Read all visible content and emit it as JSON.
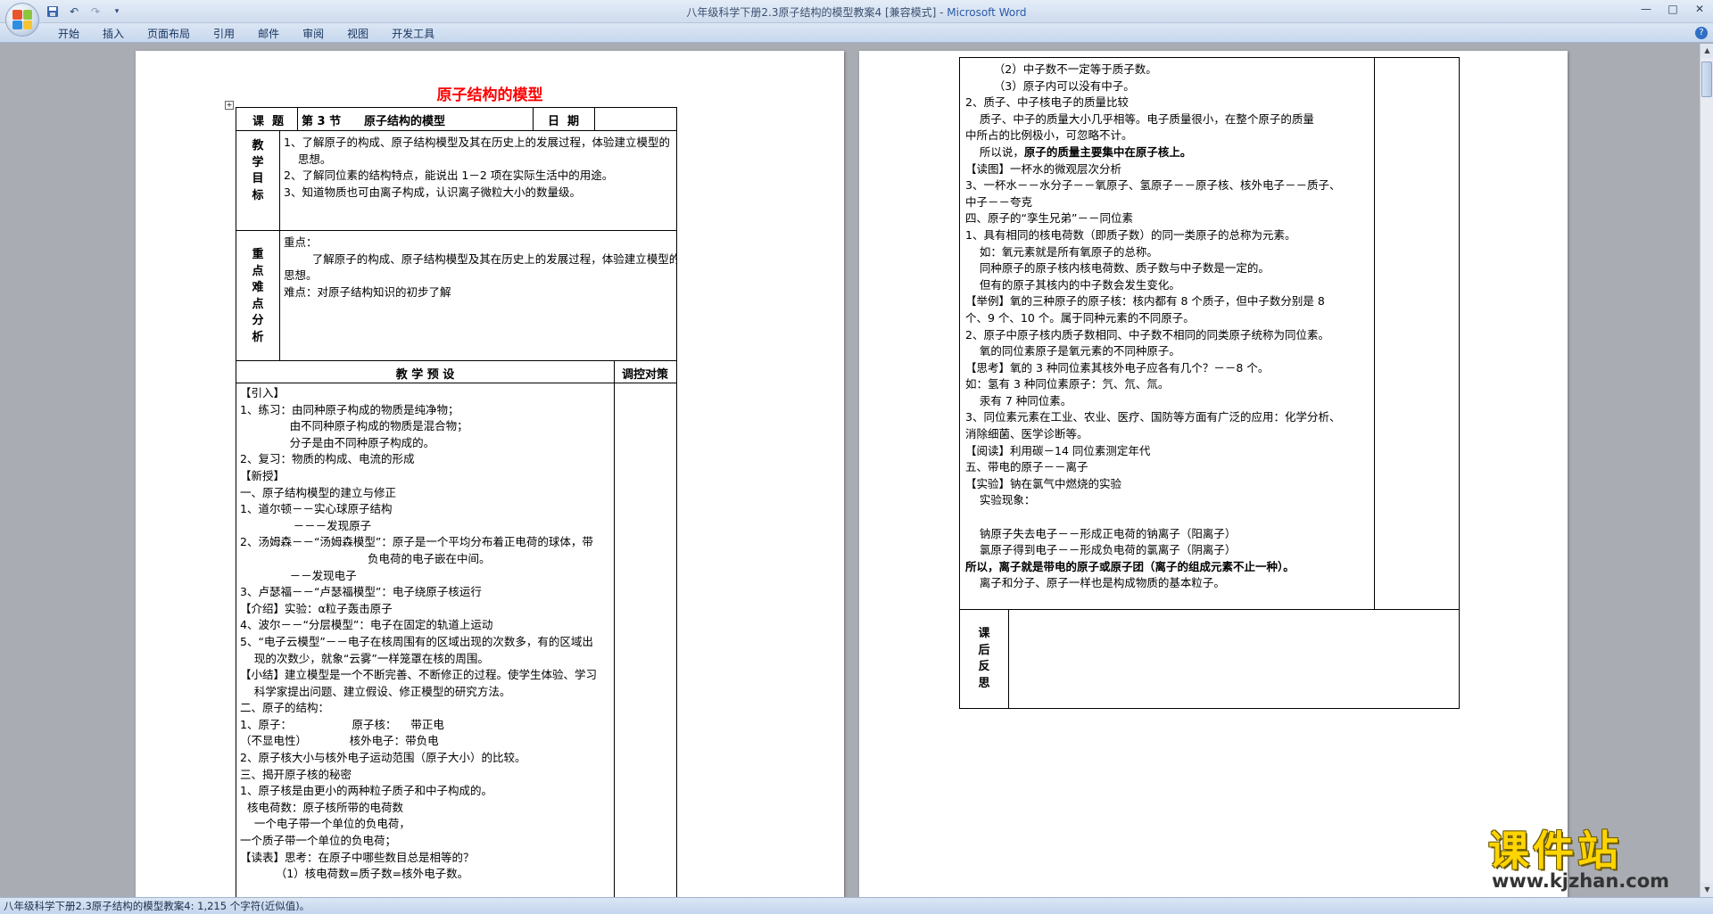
{
  "window": {
    "title": "八年级科学下册2.3原子结构的模型教案4 [兼容模式] - ",
    "app_name": "Microsoft Word"
  },
  "qat": {
    "save_icon": "save-icon",
    "undo_icon": "undo-icon",
    "redo_icon": "redo-icon",
    "customize_icon": "dropdown-icon"
  },
  "ribbon": {
    "tabs": [
      "开始",
      "插入",
      "页面布局",
      "引用",
      "邮件",
      "审阅",
      "视图",
      "开发工具"
    ]
  },
  "doc": {
    "title": "原子结构的模型",
    "header_row": {
      "label": "课  题",
      "section": "第 3 节",
      "topic": "原子结构的模型",
      "date_label": "日  期"
    },
    "goals_label": [
      "教",
      "学",
      "目",
      "标"
    ],
    "goals": [
      "1、了解原子的构成、原子结构模型及其在历史上的发展过程，体验建立模型的",
      "    思想。",
      "2、了解同位素的结构特点，能说出 1－2 项在实际生活中的用途。",
      "3、知道物质也可由离子构成，认识离子微粒大小的数量级。"
    ],
    "key_label": [
      "重",
      "点",
      "难",
      "点",
      "分",
      "析"
    ],
    "key_points": [
      "重点：",
      "        了解原子的构成、原子结构模型及其在历史上的发展过程，体验建立模型的",
      "思想。",
      "难点：对原子结构知识的初步了解"
    ],
    "plan_header": "教 学 预 设",
    "adjust_header": "调控对策",
    "plan_lines": [
      "【引入】",
      "1、练习：由同种原子构成的物质是纯净物；",
      "              由不同种原子构成的物质是混合物；",
      "              分子是由不同种原子构成的。",
      "2、复习：物质的构成、电流的形成",
      "【新授】",
      "一、原子结构模型的建立与修正",
      "1、道尔顿－－实心球原子结构",
      "               －－－发现原子",
      "2、汤姆森－－“汤姆森模型”：原子是一个平均分布着正电荷的球体，带",
      "                                    负电荷的电子嵌在中间。",
      "              －－发现电子",
      "3、卢瑟福－－“卢瑟福模型”：电子绕原子核运行",
      "【介绍】实验：α粒子轰击原子",
      "4、波尔－－“分层模型”：电子在固定的轨道上运动",
      "5、“电子云模型”－－电子在核周围有的区域出现的次数多，有的区域出",
      "    现的次数少，就象“云雾”一样笼罩在核的周围。",
      "【小结】建立模型是一个不断完善、不断修正的过程。使学生体验、学习",
      "    科学家提出问题、建立假设、修正模型的研究方法。",
      "二、原子的结构：",
      "1、原子：                 原子核：    带正电",
      "（不显电性）            核外电子：带负电",
      "2、原子核大小与核外电子运动范围（原子大小）的比较。",
      "三、揭开原子核的秘密",
      "1、原子核是由更小的两种粒子质子和中子构成的。",
      "  核电荷数：原子核所带的电荷数",
      "    一个电子带一个单位的负电荷，",
      "一个质子带一个单位的负电荷；",
      "【读表】思考：在原子中哪些数目总是相等的？",
      "          （1）核电荷数=质子数=核外电子数。"
    ],
    "page2_lines": [
      "        （2）中子数不一定等于质子数。",
      "        （3）原子内可以没有中子。",
      "2、质子、中子核电子的质量比较",
      "    质子、中子的质量大小几乎相等。电子质量很小，在整个原子的质量",
      "中所占的比例极小，可忽略不计。",
      "    所以说，原子的质量主要集中在原子核上。",
      "【读图】一杯水的微观层次分析",
      "3、一杯水－－水分子－－氧原子、氢原子－－原子核、核外电子－－质子、",
      "中子－－夸克",
      "四、原子的“孪生兄弟”－－同位素",
      "1、具有相同的核电荷数（即质子数）的同一类原子的总称为元素。",
      "    如：氧元素就是所有氧原子的总称。",
      "    同种原子的原子核内核电荷数、质子数与中子数是一定的。",
      "    但有的原子其核内的中子数会发生变化。",
      "【举例】氧的三种原子的原子核：核内都有 8 个质子，但中子数分别是 8",
      "个、9 个、10 个。属于同种元素的不同原子。",
      "2、原子中原子核内质子数相同、中子数不相同的同类原子统称为同位素。",
      "    氧的同位素原子是氧元素的不同种原子。",
      "【思考】氧的 3 种同位素其核外电子应各有几个？－－8 个。",
      "如：氢有 3 种同位素原子：氕、氘、氚。",
      "    汞有 7 种同位素。",
      "3、同位素元素在工业、农业、医疗、国防等方面有广泛的应用：化学分析、",
      "消除细菌、医学诊断等。",
      "【阅读】利用碳－14 同位素测定年代",
      "五、带电的原子－－离子",
      "【实验】钠在氯气中燃烧的实验",
      "    实验现象：",
      "",
      "    钠原子失去电子－－形成正电荷的钠离子（阳离子）",
      "    氯原子得到电子－－形成负电荷的氯离子（阴离子）",
      "所以，离子就是带电的原子或原子团（离子的组成元素不止一种）。",
      "    离子和分子、原子一样也是构成物质的基本粒子。"
    ],
    "page2_bold_prefix": "所以说，",
    "page2_bold_main": "原子的质量主要集中在原子核上。",
    "reflect_label": [
      "课",
      "后",
      "反",
      "思"
    ]
  },
  "statusbar": {
    "text": "八年级科学下册2.3原子结构的模型教案4: 1,215 个字符(近似值)。"
  },
  "watermark": {
    "cn": "课件站",
    "url": "www.kjzhan.com"
  },
  "colors": {
    "title_red": "#ff0000",
    "watermark_yellow": "#ffd400"
  }
}
